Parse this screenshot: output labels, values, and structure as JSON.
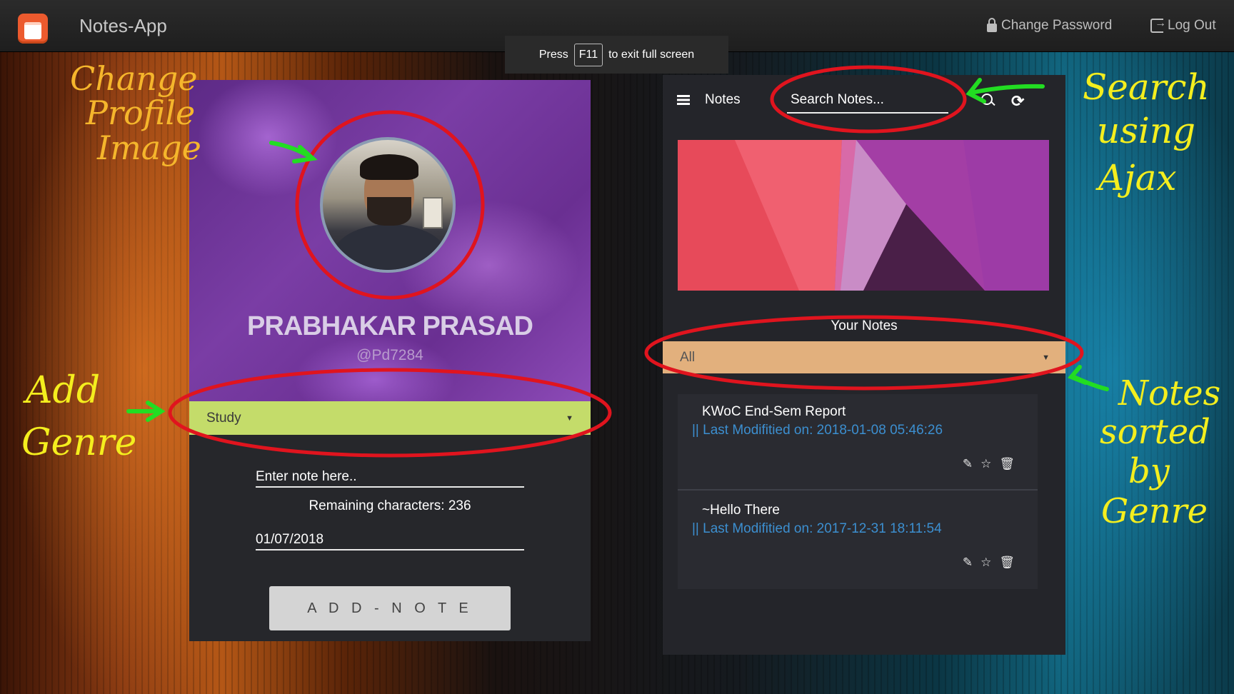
{
  "topbar": {
    "app_title": "Notes-App",
    "change_password": "Change Password",
    "log_out": "Log Out",
    "logo_icon": "notes-app-logo"
  },
  "fullscreen_toast": {
    "before": "Press",
    "key": "F11",
    "after": "to exit full screen"
  },
  "profile": {
    "name": "PRABHAKAR PRASAD",
    "handle": "@Pd7284",
    "genre_selected": "Study",
    "note_placeholder": "Enter note here..",
    "remaining_characters": "Remaining characters: 236",
    "date_value": "01/07/2018",
    "add_button": "A D D - N O T E"
  },
  "notes_panel": {
    "title": "Notes",
    "search_placeholder": "Search Notes...",
    "section_title": "Your Notes",
    "filter_selected": "All",
    "notes": [
      {
        "title": "KWoC End-Sem Report",
        "modified": "|| Last Modifitied on: 2018-01-08 05:46:26"
      },
      {
        "title": "~Hello There",
        "modified": "|| Last Modifitied on: 2017-12-31 18:11:54"
      }
    ]
  },
  "annotations": {
    "change_profile": [
      "Change",
      "Profile",
      "Image"
    ],
    "add_genre": [
      "Add",
      "Genre"
    ],
    "search_ajax": [
      "Search",
      "using",
      "Ajax"
    ],
    "notes_sorted": [
      "Notes",
      "sorted",
      "by",
      "Genre"
    ]
  },
  "colors": {
    "accent_green": "#c4dc6a",
    "filter_orange": "#e2b07d",
    "link_blue": "#3c8fd0",
    "annotation_red": "#e0141e",
    "arrow_green": "#22dd22"
  }
}
